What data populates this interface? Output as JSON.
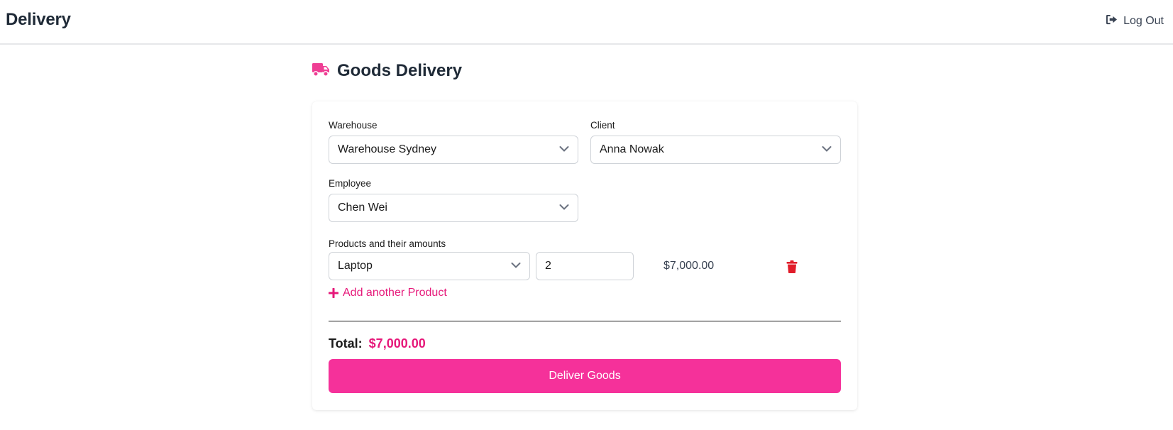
{
  "header": {
    "app_title": "Delivery",
    "logout_label": "Log Out",
    "logout_icon": "sign-out-icon"
  },
  "page": {
    "title": "Goods Delivery",
    "title_icon": "truck-icon"
  },
  "form": {
    "warehouse": {
      "label": "Warehouse",
      "value": "Warehouse Sydney"
    },
    "client": {
      "label": "Client",
      "value": "Anna Nowak"
    },
    "employee": {
      "label": "Employee",
      "value": "Chen Wei"
    },
    "products": {
      "label": "Products and their amounts",
      "rows": [
        {
          "product": "Laptop",
          "quantity": "2",
          "price": "$7,000.00"
        }
      ],
      "add_label": "Add another Product"
    },
    "total_label": "Total:",
    "total_value": "$7,000.00",
    "submit_label": "Deliver Goods"
  },
  "colors": {
    "accent": "#f5319a",
    "accent_text": "#e6197a",
    "danger": "#e11d2a"
  }
}
